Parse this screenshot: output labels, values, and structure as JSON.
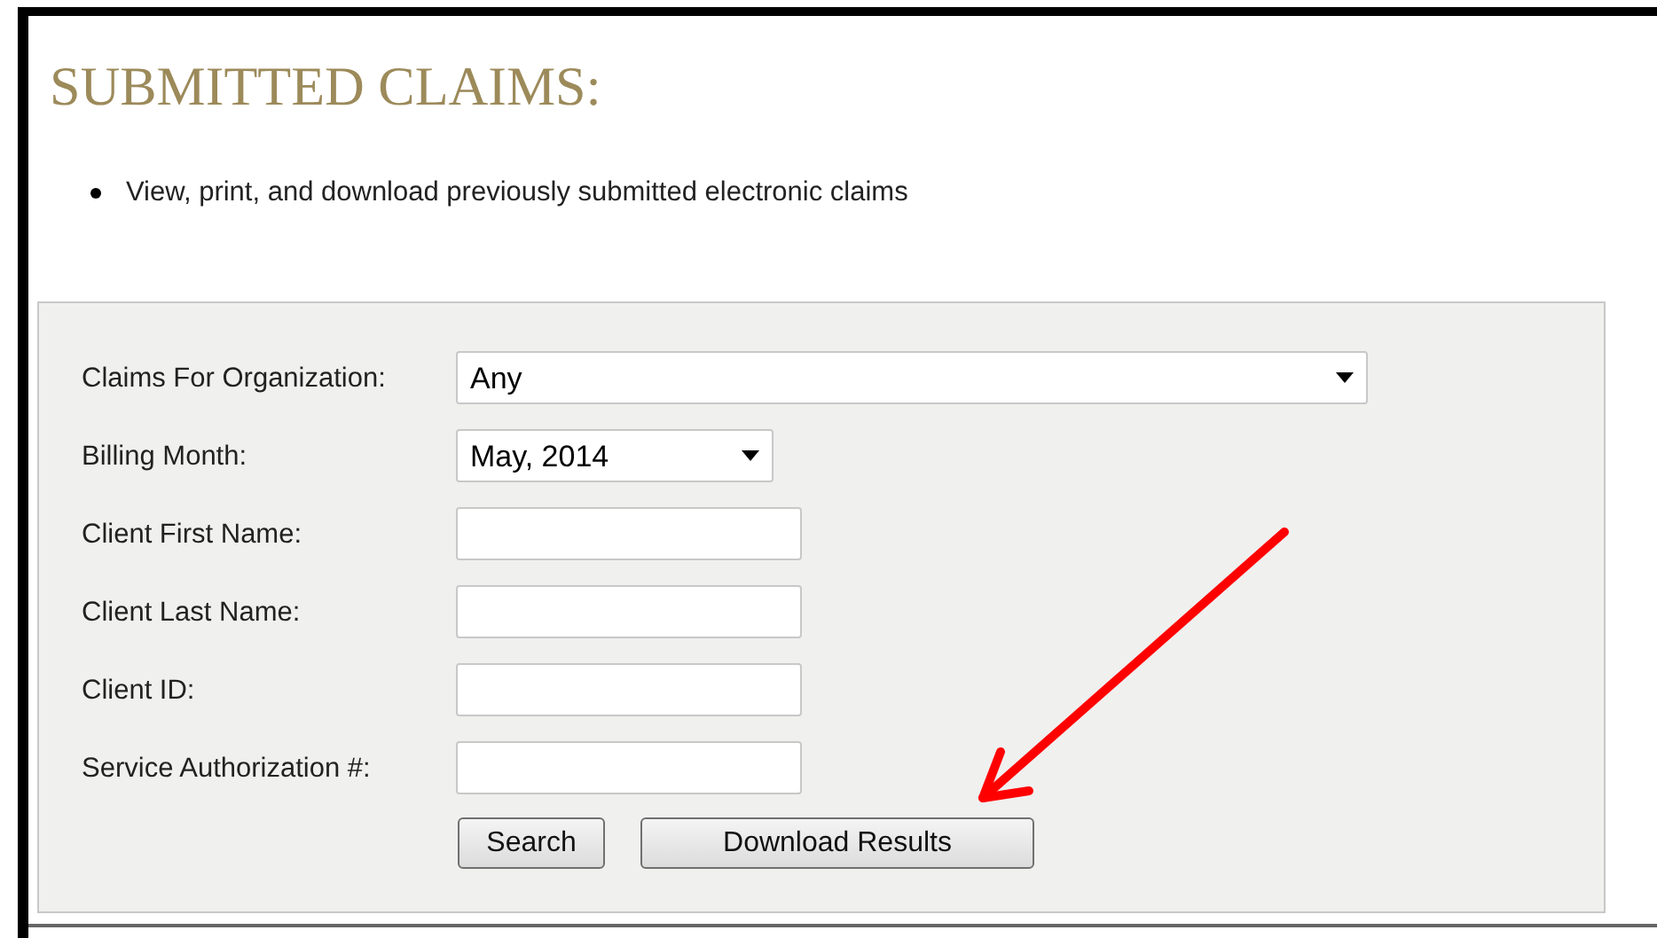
{
  "title": "SUBMITTED CLAIMS:",
  "bullets": [
    "View, print, and download previously submitted electronic claims"
  ],
  "form": {
    "fields": [
      {
        "kind": "select",
        "label": "Claims For Organization:",
        "value": "Any"
      },
      {
        "kind": "select",
        "label": "Billing Month:",
        "value": "May, 2014"
      },
      {
        "kind": "text",
        "label": "Client First Name:"
      },
      {
        "kind": "text",
        "label": "Client Last Name:"
      },
      {
        "kind": "text",
        "label": "Client ID:"
      },
      {
        "kind": "text",
        "label": "Service Authorization #:"
      }
    ],
    "buttons": [
      "Search",
      "Download Results"
    ]
  }
}
